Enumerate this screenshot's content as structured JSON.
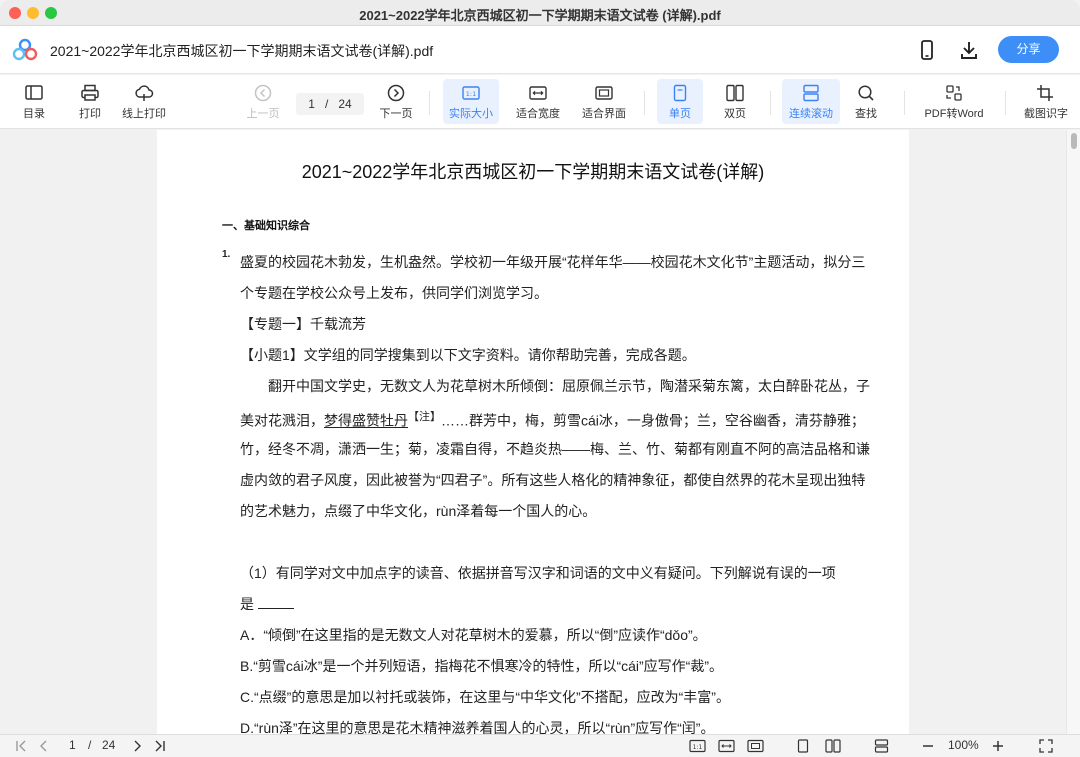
{
  "window": {
    "title": "2021~2022学年北京西城区初一下学期期末语文试卷 (详解).pdf"
  },
  "header": {
    "doc_title": "2021~2022学年北京西城区初一下学期期末语文试卷(详解).pdf",
    "share_label": "分享",
    "icons": [
      "app-logo",
      "phone-icon",
      "download-icon"
    ]
  },
  "toolbar": {
    "toc": "目录",
    "print": "打印",
    "online_print": "线上打印",
    "prev_page": "上一页",
    "page_current": "1",
    "page_sep": "/",
    "page_total": "24",
    "next_page": "下一页",
    "actual_size": "实际大小",
    "fit_width": "适合宽度",
    "fit_page": "适合界面",
    "single_page": "单页",
    "double_page": "双页",
    "continuous": "连续滚动",
    "find": "查找",
    "pdf_to_word": "PDF转Word",
    "screenshot_ocr": "截图识字",
    "active_color": "#3b82f6"
  },
  "document": {
    "title": "2021~2022学年北京西城区初一下学期期末语文试卷(详解)",
    "section": "一、基础知识综合",
    "q_number": "1.",
    "lines": [
      "盛夏的校园花木勃发，生机盎然。学校初一年级开展“花样年华——校园花木文化节”主题活动，拟分三",
      "个专题在学校公众号上发布，供同学们浏览学习。",
      "【专题一】千载流芳",
      "【小题1】文学组的同学搜集到以下文字资料。请你帮助完善，完成各题。",
      "　　翻开中国文学史，无数文人为花草树木所倾倒：屈原佩兰示节，陶潜采菊东篱，太白醉卧花丛，子",
      "美对花溅泪，",
      "梦得盛赞牡丹",
      "【注】",
      "……群芳中，梅，剪雪cái冰，一身傲骨；兰，空谷幽香，清芬静雅；",
      "竹，经冬不凋，潇洒一生；菊，凌霜自得，不趋炎热——梅、兰、竹、菊都有刚直不阿的高洁品格和谦",
      "虚内敛的君子风度，因此被誉为“四君子”。所有这些人格化的精神象征，都使自然界的花木呈现出独特",
      "的艺术魅力，点缀了中华文化，rùn泽着每一个国人的心。",
      "（1）有同学对文中加点字的读音、依据拼音写汉字和词语的文中义有疑问。下列解说有误的一项",
      "是",
      "A．“倾倒”在这里指的是无数文人对花草树木的爱慕，所以“倒”应读作“dǒo”。",
      "B.“剪雪cái冰”是一个并列短语，指梅花不惧寒冷的特性，所以“cái”应写作“裁”。",
      "C.“点缀”的意思是加以衬托或装饰，在这里与“中华文化”不搭配，应改为“丰富”。",
      "D.“rùn泽”在这里的意思是花木精神滋养着国人的心灵，所以“rùn”应写作“闰”。"
    ]
  },
  "bottombar": {
    "page_current": "1",
    "page_sep": "/",
    "page_total": "24",
    "zoom": "100%"
  }
}
